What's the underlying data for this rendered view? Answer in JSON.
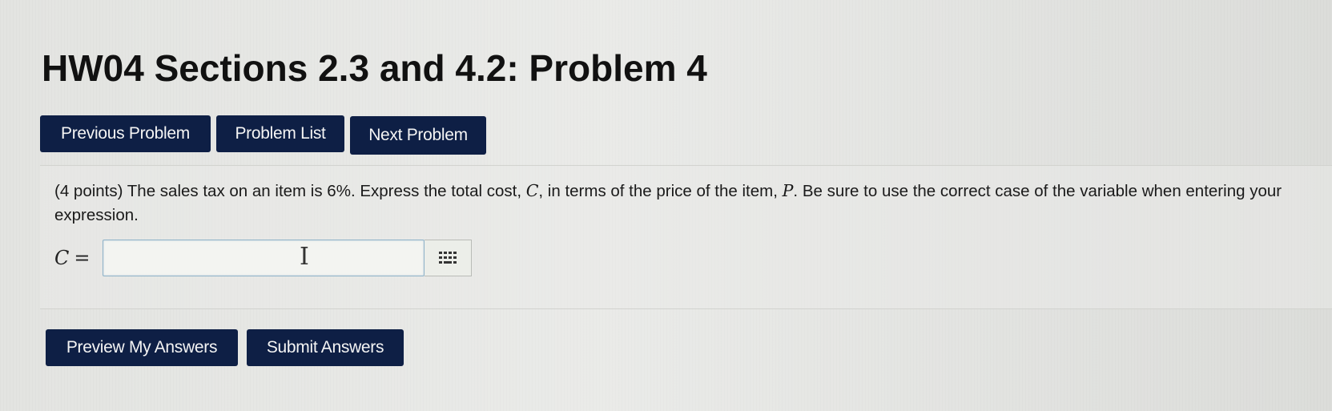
{
  "page": {
    "title": "HW04 Sections 2.3 and 4.2: Problem 4"
  },
  "nav": {
    "previous_label": "Previous Problem",
    "list_label": "Problem List",
    "next_label": "Next Problem"
  },
  "problem": {
    "text_part1": "(4 points) The sales tax on an item is 6%. Express the total cost, ",
    "var_c": "C",
    "text_part2": ", in terms of the price of the item, ",
    "var_p": "P",
    "text_part3": ". Be sure to use the correct case of the variable when entering your expression.",
    "answer_label_var": "C",
    "answer_label_eq": "=",
    "answer_value": "",
    "text_cursor_icon": "I-beam-cursor-icon",
    "equation_editor_icon": "keypad-grid-icon"
  },
  "actions": {
    "preview_label": "Preview My Answers",
    "submit_label": "Submit Answers"
  },
  "colors": {
    "button_bg": "#0e1f45",
    "button_text": "#f4f4f4",
    "page_bg": "#e3e4e1",
    "input_border": "#8fb3c9"
  }
}
